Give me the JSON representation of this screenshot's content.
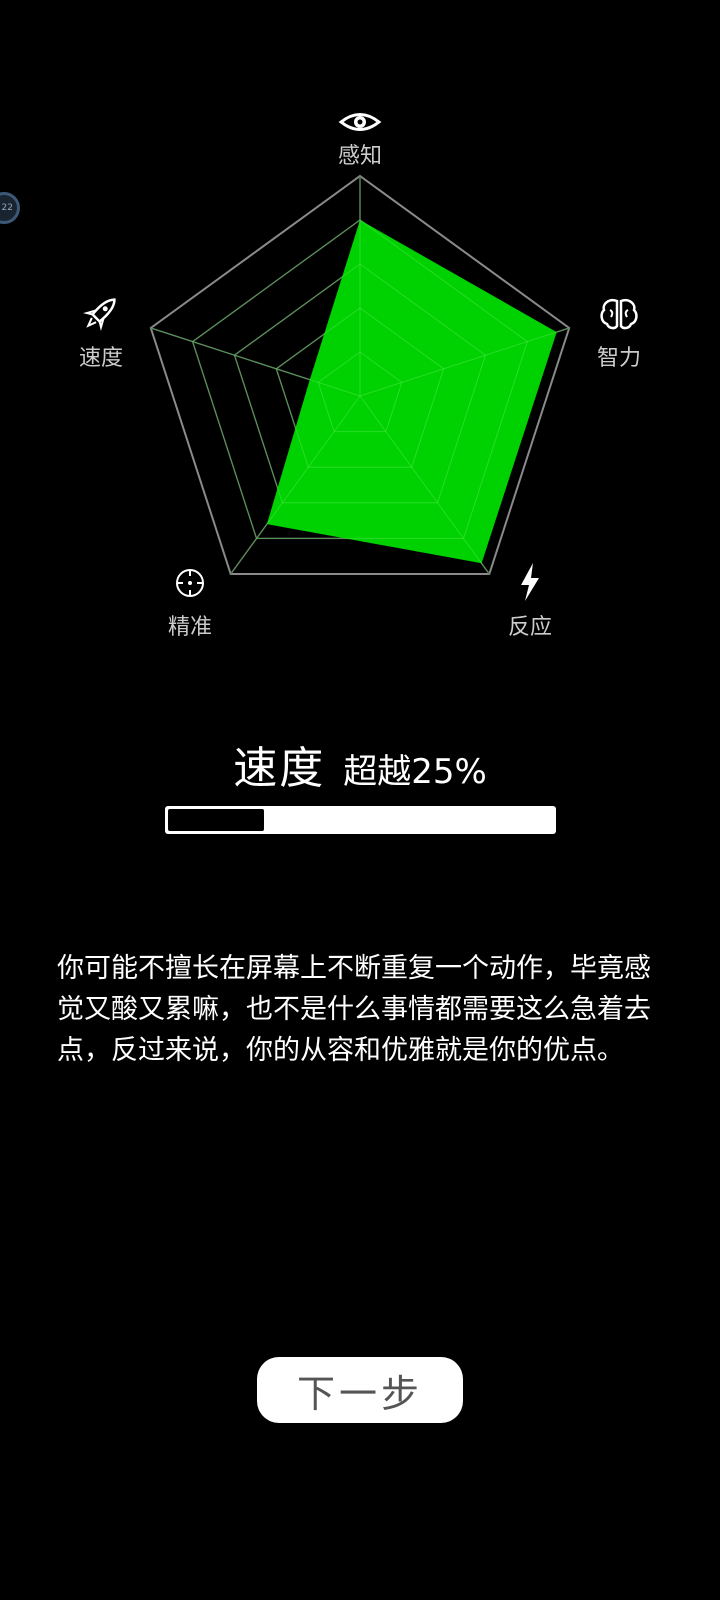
{
  "radar": {
    "max": 5,
    "levels": 5,
    "axes": [
      {
        "key": "perception",
        "label": "感知",
        "icon": "eye-icon",
        "value": 4.0
      },
      {
        "key": "intelligence",
        "label": "智力",
        "icon": "brain-icon",
        "value": 4.7
      },
      {
        "key": "reaction",
        "label": "反应",
        "icon": "lightning-icon",
        "value": 4.7
      },
      {
        "key": "precision",
        "label": "精准",
        "icon": "crosshair-icon",
        "value": 3.6
      },
      {
        "key": "speed",
        "label": "速度",
        "icon": "rocket-icon",
        "value": 1.2
      }
    ],
    "fill_color": "#00d100",
    "grid_outer_color": "#8a8a8a",
    "grid_inner_color": "#555555",
    "grid_overlay_color": "#55ee55",
    "label_color": "#cccccc"
  },
  "result": {
    "stat_name": "速度",
    "percent_label": "超越25%",
    "progress": 0.25
  },
  "description": "你可能不擅长在屏幕上不断重复一个动作，毕竟感觉又酸又累嘛，也不是什么事情都需要这么急着去点，反过来说，你的从容和优雅就是你的优点。",
  "next_button_label": "下一步",
  "floating_badge_text": "22"
}
